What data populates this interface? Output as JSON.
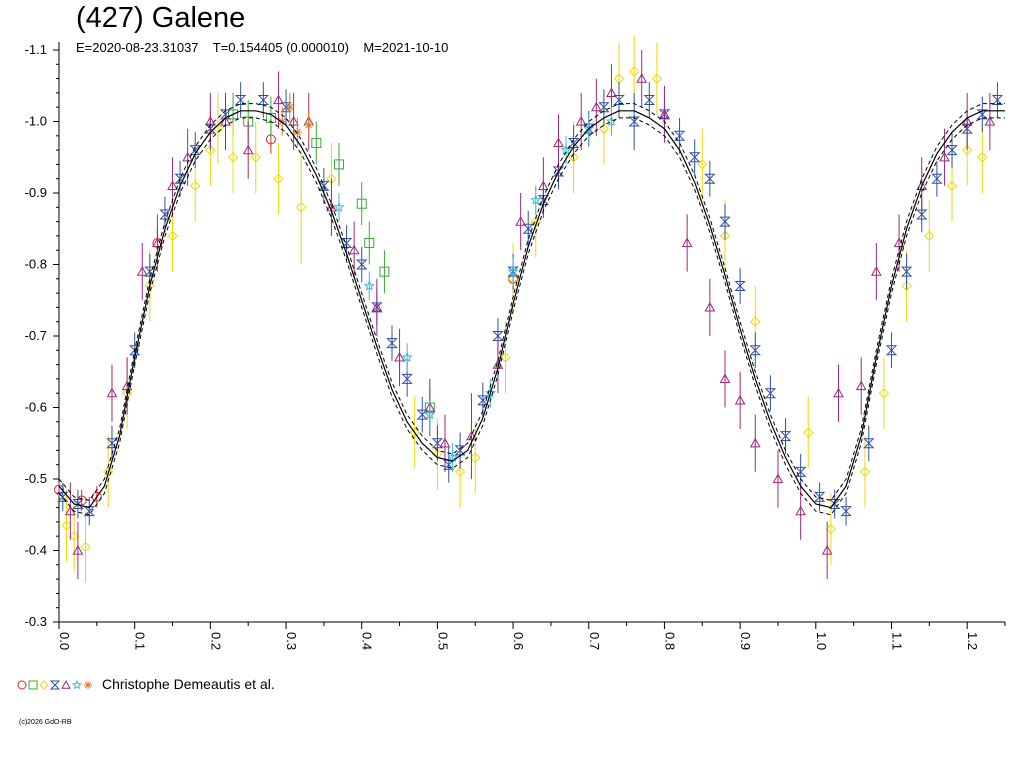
{
  "header": {
    "title": "(427) Galene",
    "subtitle": "E=2020-08-23.31037    T=0.154405 (0.000010)    M=2021-10-10"
  },
  "legend": {
    "label": "Christophe Demeautis et al."
  },
  "footer": {
    "copyright": "(c)2026 GdO-RB"
  },
  "chart_data": {
    "type": "scatter",
    "title": "(427) Galene",
    "subtitle": "E=2020-08-23.31037    T=0.154405 (0.000010)    M=2021-10-10",
    "xlabel": "",
    "ylabel": "",
    "xlim": [
      0.0,
      1.25
    ],
    "ylim": [
      -0.3,
      -1.1
    ],
    "y_inverted": true,
    "x_ticks": [
      0.0,
      0.1,
      0.2,
      0.3,
      0.4,
      0.5,
      0.6,
      0.7,
      0.8,
      0.9,
      1.0,
      1.1,
      1.2
    ],
    "x_tick_labels": [
      "0.0",
      "0.1",
      "0.2",
      "0.3",
      "0.4",
      "0.5",
      "0.6",
      "0.7",
      "0.8",
      "0.9",
      "1.0",
      "1.1",
      "1.2"
    ],
    "y_ticks": [
      -0.3,
      -0.4,
      -0.5,
      -0.6,
      -0.7,
      -0.8,
      -0.9,
      -1.0,
      -1.1
    ],
    "y_tick_labels": [
      "-0.3",
      "-0.4",
      "-0.5",
      "-0.6",
      "-0.7",
      "-0.8",
      "-0.9",
      "-1.0",
      "-1.1"
    ],
    "grid": false,
    "legend_position": "bottom-left",
    "period_repeat": 1.0,
    "fit_curve": {
      "style": "solid black with dashed black envelope",
      "x": [
        0.0,
        0.02,
        0.04,
        0.06,
        0.08,
        0.1,
        0.12,
        0.14,
        0.16,
        0.18,
        0.2,
        0.22,
        0.24,
        0.26,
        0.28,
        0.3,
        0.32,
        0.34,
        0.36,
        0.38,
        0.4,
        0.42,
        0.44,
        0.46,
        0.48,
        0.5,
        0.52,
        0.54,
        0.56,
        0.58,
        0.6,
        0.62,
        0.64,
        0.66,
        0.68,
        0.7,
        0.72,
        0.74,
        0.76,
        0.78,
        0.8,
        0.82,
        0.84,
        0.86,
        0.88,
        0.9,
        0.92,
        0.94,
        0.96,
        0.98,
        1.0,
        1.02,
        1.04,
        1.06,
        1.08,
        1.1,
        1.12,
        1.14,
        1.16,
        1.18,
        1.2,
        1.22,
        1.24,
        1.25
      ],
      "y": [
        -0.49,
        -0.465,
        -0.46,
        -0.49,
        -0.56,
        -0.67,
        -0.77,
        -0.85,
        -0.91,
        -0.955,
        -0.985,
        -1.005,
        -1.015,
        -1.015,
        -1.01,
        -0.995,
        -0.965,
        -0.925,
        -0.875,
        -0.815,
        -0.75,
        -0.685,
        -0.625,
        -0.58,
        -0.55,
        -0.53,
        -0.525,
        -0.54,
        -0.585,
        -0.655,
        -0.745,
        -0.825,
        -0.885,
        -0.93,
        -0.965,
        -0.99,
        -1.005,
        -1.015,
        -1.015,
        -1.005,
        -0.99,
        -0.96,
        -0.915,
        -0.855,
        -0.785,
        -0.71,
        -0.64,
        -0.58,
        -0.53,
        -0.49,
        -0.465,
        -0.46,
        -0.49,
        -0.56,
        -0.67,
        -0.77,
        -0.85,
        -0.91,
        -0.955,
        -0.985,
        -1.005,
        -1.015,
        -1.015,
        -1.015
      ],
      "envelope_offset": 0.01
    },
    "series": [
      {
        "color": "#e8202a",
        "marker": "circle",
        "x": [
          0.0,
          0.03,
          0.05,
          0.13,
          0.28,
          0.6
        ],
        "y": [
          -0.485,
          -0.47,
          -0.475,
          -0.83,
          -0.975,
          -0.78
        ],
        "err": [
          0.01,
          0.015,
          0.015,
          0.02,
          0.02,
          0.02
        ]
      },
      {
        "color": "#3aa83a",
        "marker": "square",
        "x": [
          0.23,
          0.25,
          0.28,
          0.34,
          0.37,
          0.4,
          0.41,
          0.43,
          0.49
        ],
        "y": [
          -1.01,
          -1.0,
          -1.005,
          -0.97,
          -0.94,
          -0.885,
          -0.83,
          -0.79,
          -0.6
        ],
        "err": [
          0.03,
          0.03,
          0.03,
          0.03,
          0.03,
          0.03,
          0.03,
          0.03,
          0.03
        ]
      },
      {
        "color": "#f2d800",
        "marker": "diamond",
        "x": [
          0.01,
          0.02,
          0.035,
          0.065,
          0.09,
          0.12,
          0.15,
          0.18,
          0.2,
          0.21,
          0.23,
          0.26,
          0.29,
          0.32,
          0.36,
          0.47,
          0.5,
          0.53,
          0.55,
          0.59,
          0.6,
          0.63,
          0.68,
          0.72,
          0.74,
          0.76,
          0.79,
          0.85,
          0.88,
          0.92,
          0.99,
          1.02,
          1.065,
          1.09,
          1.12,
          1.15,
          1.18,
          1.2,
          1.22
        ],
        "y": [
          -0.435,
          -0.42,
          -0.405,
          -0.51,
          -0.62,
          -0.77,
          -0.84,
          -0.91,
          -0.96,
          -0.99,
          -0.95,
          -0.95,
          -0.92,
          -0.88,
          -0.92,
          -0.565,
          -0.535,
          -0.51,
          -0.53,
          -0.67,
          -0.78,
          -0.86,
          -0.95,
          -0.99,
          -1.06,
          -1.07,
          -1.06,
          -0.94,
          -0.84,
          -0.72,
          -0.565,
          -0.43,
          -0.51,
          -0.62,
          -0.77,
          -0.84,
          -0.91,
          -0.96,
          -0.95
        ],
        "err": [
          0.05,
          0.05,
          0.05,
          0.05,
          0.05,
          0.05,
          0.05,
          0.05,
          0.05,
          0.05,
          0.05,
          0.05,
          0.05,
          0.08,
          0.05,
          0.05,
          0.05,
          0.05,
          0.05,
          0.05,
          0.05,
          0.05,
          0.05,
          0.05,
          0.05,
          0.05,
          0.05,
          0.05,
          0.05,
          0.05,
          0.05,
          0.05,
          0.05,
          0.05,
          0.05,
          0.05,
          0.05,
          0.05,
          0.05
        ]
      },
      {
        "color": "#3050a8",
        "marker": "bowtie",
        "x": [
          0.005,
          0.025,
          0.04,
          0.07,
          0.1,
          0.12,
          0.14,
          0.16,
          0.18,
          0.2,
          0.22,
          0.24,
          0.27,
          0.3,
          0.35,
          0.38,
          0.4,
          0.42,
          0.44,
          0.46,
          0.48,
          0.5,
          0.515,
          0.53,
          0.56,
          0.58,
          0.6,
          0.62,
          0.64,
          0.66,
          0.68,
          0.7,
          0.72,
          0.74,
          0.76,
          0.78,
          0.8,
          0.82,
          0.84,
          0.86,
          0.88,
          0.9,
          0.92,
          0.94,
          0.96,
          0.98,
          1.005,
          1.025,
          1.04,
          1.07,
          1.1,
          1.12,
          1.14,
          1.16,
          1.18,
          1.2,
          1.22,
          1.24
        ],
        "y": [
          -0.475,
          -0.465,
          -0.455,
          -0.55,
          -0.68,
          -0.79,
          -0.87,
          -0.92,
          -0.96,
          -0.99,
          -1.01,
          -1.03,
          -1.03,
          -1.02,
          -0.91,
          -0.83,
          -0.8,
          -0.74,
          -0.69,
          -0.64,
          -0.59,
          -0.55,
          -0.52,
          -0.54,
          -0.61,
          -0.7,
          -0.79,
          -0.85,
          -0.89,
          -0.93,
          -0.97,
          -0.99,
          -1.02,
          -1.03,
          -1.0,
          -1.03,
          -1.01,
          -0.98,
          -0.95,
          -0.92,
          -0.86,
          -0.77,
          -0.68,
          -0.62,
          -0.56,
          -0.51,
          -0.475,
          -0.465,
          -0.455,
          -0.55,
          -0.68,
          -0.79,
          -0.87,
          -0.92,
          -0.96,
          -0.99,
          -1.01,
          -1.03
        ],
        "err": [
          0.02,
          0.02,
          0.02,
          0.025,
          0.025,
          0.025,
          0.025,
          0.025,
          0.025,
          0.025,
          0.025,
          0.025,
          0.025,
          0.025,
          0.025,
          0.025,
          0.025,
          0.025,
          0.025,
          0.025,
          0.025,
          0.025,
          0.025,
          0.025,
          0.025,
          0.025,
          0.025,
          0.025,
          0.025,
          0.025,
          0.025,
          0.025,
          0.025,
          0.025,
          0.04,
          0.025,
          0.025,
          0.025,
          0.025,
          0.025,
          0.025,
          0.025,
          0.025,
          0.025,
          0.025,
          0.025,
          0.02,
          0.02,
          0.02,
          0.025,
          0.025,
          0.025,
          0.025,
          0.025,
          0.025,
          0.025,
          0.025,
          0.025
        ]
      },
      {
        "color": "#a0267a",
        "marker": "triangle",
        "x": [
          0.015,
          0.025,
          0.07,
          0.09,
          0.11,
          0.13,
          0.15,
          0.17,
          0.2,
          0.22,
          0.25,
          0.29,
          0.31,
          0.33,
          0.36,
          0.39,
          0.42,
          0.45,
          0.49,
          0.51,
          0.545,
          0.58,
          0.61,
          0.64,
          0.66,
          0.69,
          0.71,
          0.73,
          0.77,
          0.8,
          0.83,
          0.86,
          0.88,
          0.9,
          0.92,
          0.95,
          0.98,
          1.015,
          1.03,
          1.06,
          1.08,
          1.11,
          1.14,
          1.17,
          1.2,
          1.23
        ],
        "y": [
          -0.455,
          -0.4,
          -0.62,
          -0.63,
          -0.79,
          -0.83,
          -0.91,
          -0.95,
          -1.0,
          -1.0,
          -0.96,
          -1.03,
          -1.0,
          -1.0,
          -0.88,
          -0.82,
          -0.74,
          -0.67,
          -0.6,
          -0.55,
          -0.56,
          -0.66,
          -0.86,
          -0.91,
          -0.97,
          -1.0,
          -1.02,
          -1.04,
          -1.06,
          -1.01,
          -0.83,
          -0.74,
          -0.64,
          -0.61,
          -0.55,
          -0.5,
          -0.455,
          -0.4,
          -0.62,
          -0.63,
          -0.79,
          -0.83,
          -0.91,
          -0.95,
          -1.0,
          -1.0
        ],
        "err": [
          0.04,
          0.04,
          0.04,
          0.04,
          0.04,
          0.04,
          0.04,
          0.04,
          0.04,
          0.04,
          0.04,
          0.04,
          0.04,
          0.04,
          0.04,
          0.04,
          0.04,
          0.04,
          0.04,
          0.04,
          0.06,
          0.04,
          0.04,
          0.04,
          0.04,
          0.04,
          0.04,
          0.04,
          0.04,
          0.04,
          0.04,
          0.04,
          0.04,
          0.04,
          0.04,
          0.04,
          0.04,
          0.04,
          0.04,
          0.04,
          0.04,
          0.04,
          0.04,
          0.04,
          0.04,
          0.04
        ]
      },
      {
        "color": "#40b8d8",
        "marker": "star",
        "x": [
          0.37,
          0.41,
          0.46,
          0.49,
          0.52,
          0.57,
          0.6,
          0.63,
          0.67,
          0.7,
          0.73
        ],
        "y": [
          -0.88,
          -0.77,
          -0.67,
          -0.59,
          -0.53,
          -0.62,
          -0.79,
          -0.89,
          -0.96,
          -0.99,
          -1.0
        ],
        "err": [
          0.02,
          0.02,
          0.02,
          0.02,
          0.02,
          0.02,
          0.02,
          0.02,
          0.02,
          0.02,
          0.02
        ]
      },
      {
        "color": "#e07820",
        "marker": "asterisk",
        "x": [
          0.295,
          0.305,
          0.315,
          0.33
        ],
        "y": [
          -1.0,
          -1.02,
          -0.985,
          -0.995
        ],
        "err": [
          0.02,
          0.02,
          0.02,
          0.02
        ]
      }
    ]
  }
}
